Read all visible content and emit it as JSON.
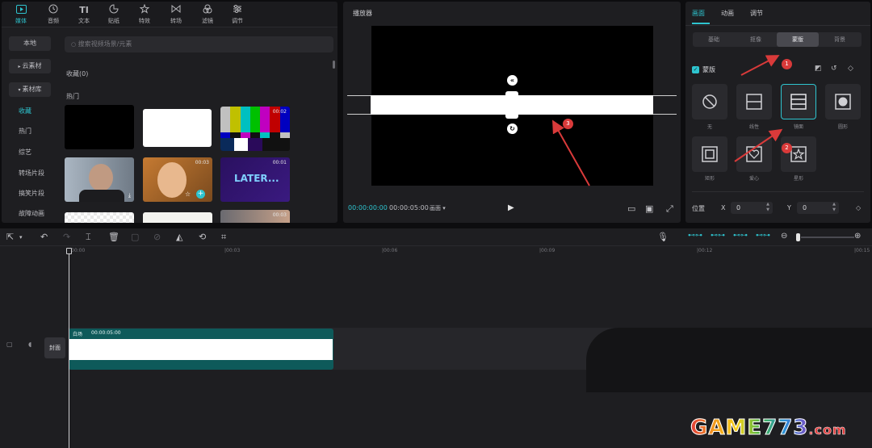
{
  "toolbar_tabs": [
    {
      "label": "媒体",
      "icon": "media-icon"
    },
    {
      "label": "音频",
      "icon": "audio-icon"
    },
    {
      "label": "文本",
      "icon": "text-icon"
    },
    {
      "label": "贴纸",
      "icon": "sticker-icon"
    },
    {
      "label": "特效",
      "icon": "effects-icon"
    },
    {
      "label": "转场",
      "icon": "transition-icon"
    },
    {
      "label": "滤镜",
      "icon": "filter-icon"
    },
    {
      "label": "调节",
      "icon": "adjust-icon"
    }
  ],
  "text_tab_glyph": "TI",
  "side_nav": {
    "local": "本地",
    "cloud": "云素材",
    "library": "素材库",
    "items": [
      "收藏",
      "热门",
      "综艺",
      "转场片段",
      "搞笑片段",
      "故障动画"
    ]
  },
  "media": {
    "search_placeholder": "搜索视频场景/元素",
    "favorites_label": "收藏(0)",
    "hot_label": "热门",
    "thumb_durations": [
      "00:02",
      "00:03",
      "00:01",
      "00:03"
    ],
    "later_text": "LATER..."
  },
  "player": {
    "title": "播放器",
    "time_current": "00:00:00:00",
    "time_total": "00:00:05:00",
    "ratio": "画面",
    "ratio_arrow": "▾"
  },
  "props": {
    "tabs": [
      "画面",
      "动画",
      "调节"
    ],
    "segments": [
      "基础",
      "抠像",
      "蒙版",
      "背景"
    ],
    "mask_toggle": "蒙版",
    "masks": [
      {
        "label": "无",
        "icon": "no-mask-icon"
      },
      {
        "label": "线性",
        "icon": "linear-mask-icon"
      },
      {
        "label": "镜面",
        "icon": "mirror-mask-icon"
      },
      {
        "label": "圆形",
        "icon": "circle-mask-icon"
      },
      {
        "label": "矩形",
        "icon": "rectangle-mask-icon"
      },
      {
        "label": "爱心",
        "icon": "heart-mask-icon"
      },
      {
        "label": "星形",
        "icon": "star-mask-icon"
      }
    ],
    "position_label": "位置",
    "x_label": "X",
    "x_value": "0",
    "y_label": "Y",
    "y_value": "0"
  },
  "timeline": {
    "ruler_labels": [
      "00:00",
      "|00:03",
      "|00:06",
      "|00:09",
      "|00:12",
      "|00:15"
    ],
    "cover_label": "封面",
    "clip_name": "白场",
    "clip_duration": "00:00:05:00"
  },
  "annotations": [
    "1",
    "2",
    "3"
  ],
  "watermark": {
    "main": "GAME773",
    "suffix": ".com",
    "colors": [
      "#e23b3b",
      "#f29a1e",
      "#f5d21a",
      "#42b649",
      "#2b8fd9",
      "#7a4fc2",
      "#e23b3b"
    ]
  },
  "colors": {
    "accent": "#2ec4cf",
    "annotation": "#d93a3a"
  }
}
